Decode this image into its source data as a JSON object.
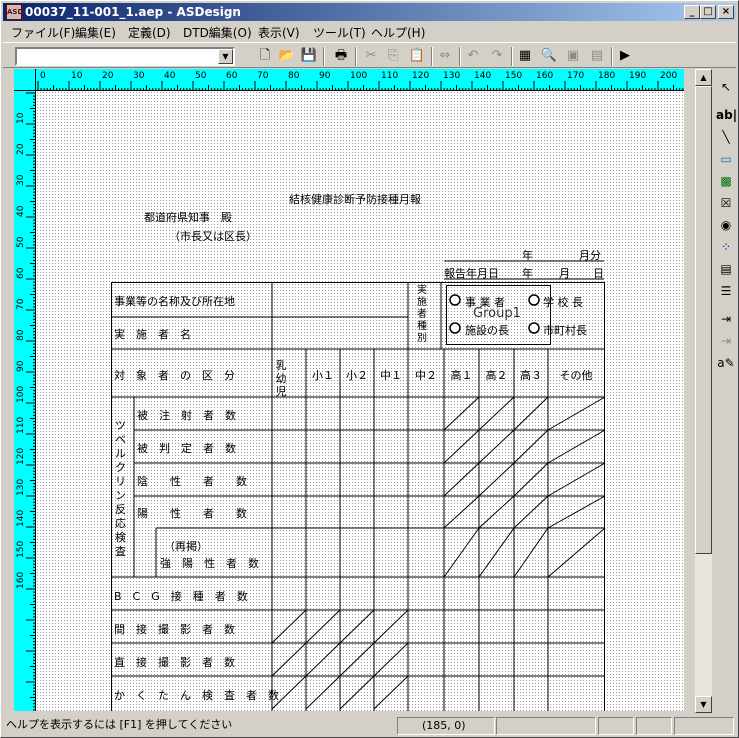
{
  "window": {
    "title": "00037_11-001_1.aep - ASDesign",
    "minimize": "_",
    "maximize": "□",
    "close": "×"
  },
  "menu": [
    "ファイル(F)",
    "編集(E)",
    "定義(D)",
    "DTD編集(O)",
    "表示(V)",
    "ツール(T)",
    "ヘルプ(H)"
  ],
  "ruler": {
    "h_ticks": [
      "0",
      "10",
      "20",
      "30",
      "40",
      "50",
      "60",
      "70",
      "80",
      "90",
      "100",
      "110",
      "120",
      "130",
      "140",
      "150",
      "160",
      "170",
      "180",
      "190",
      "200"
    ],
    "v_ticks": [
      "10",
      "20",
      "30",
      "40",
      "50",
      "60",
      "70",
      "80",
      "90",
      "100",
      "110",
      "120",
      "130",
      "140",
      "150",
      "160"
    ]
  },
  "form": {
    "title": "結核健康診断予防接種月報",
    "addressee": "都道府県知事　殿",
    "addressee_sub": "（市長又は区長）",
    "year": "年",
    "month_part": "月分",
    "report_date": "報告年月日",
    "year2": "年",
    "month2": "月",
    "day2": "日",
    "row_business": "事業等の名称及び所在地",
    "row_implementer": "実　施　者　名",
    "implementer_type": "実施者種別",
    "group_label": "Group1",
    "radios": [
      "事 業 者",
      "学 校 長",
      "施設の長",
      "市町村長"
    ],
    "target": "対　象　者　の　区　分",
    "columns": [
      "乳幼児",
      "小１",
      "小２",
      "中１",
      "中２",
      "高１",
      "高２",
      "高３",
      "その他"
    ],
    "tuberculin": "ツベルクリン反応検査",
    "rows": [
      "被　注　射　者　数",
      "被　判　定　者　数",
      "陰　　性　　者　　数",
      "陽　　性　　者　　数"
    ],
    "repost_a": "（再掲）",
    "repost_b": "強　陽　性　者　数",
    "bcg": "B　C　G　接　種　者　数",
    "indirect": "間　接　撮　影　者　数",
    "direct": "直　接　撮　影　者　数",
    "sputum": "か　く　た　ん　検　査　者　数"
  },
  "status": {
    "help": "ヘルプを表示するには [F1] を押してください",
    "coord": "(185, 0)"
  }
}
